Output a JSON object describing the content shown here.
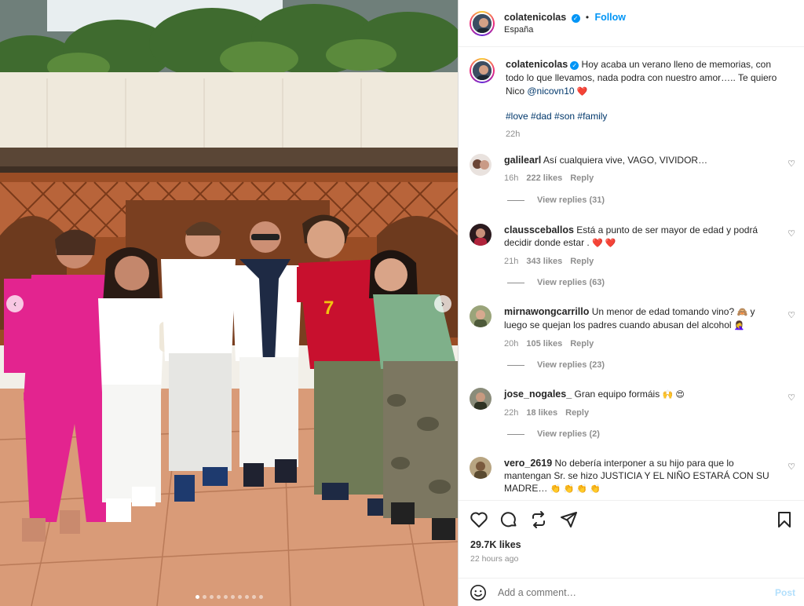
{
  "post": {
    "username": "colatenicolas",
    "follow_label": "Follow",
    "separator": "•",
    "location": "España",
    "caption": {
      "text": "Hoy acaba un verano lleno de memorias, con todo lo que llevamos, nada podra con nuestro amor….. Te quiero Nico",
      "mention": "@nicovn10",
      "emoji": "❤️",
      "hashtags": "#love #dad #son #family",
      "time": "22h"
    },
    "carousel": {
      "total_slides": 10,
      "active_slide": 1
    }
  },
  "comments": [
    {
      "username": "galilearl",
      "text": "Así cualquiera vive, VAGO, VIVIDOR…",
      "time": "16h",
      "likes": "222 likes",
      "reply": "Reply",
      "view_replies": "View replies (31)"
    },
    {
      "username": "claussceballos",
      "text": "Está a punto de ser mayor de edad y podrá decidir donde estar .",
      "emoji": "❤️ ❤️",
      "time": "21h",
      "likes": "343 likes",
      "reply": "Reply",
      "view_replies": "View replies (63)"
    },
    {
      "username": "mirnawongcarrillo",
      "text": "Un menor de edad tomando vino?",
      "emoji": "🙈",
      "text2": "y luego se quejan los padres cuando abusan del alcohol",
      "emoji2": "🤦‍♀️",
      "time": "20h",
      "likes": "105 likes",
      "reply": "Reply",
      "view_replies": "View replies (23)"
    },
    {
      "username": "jose_nogales_",
      "text": "Gran equipo formáis",
      "emoji": "🙌 😍",
      "time": "22h",
      "likes": "18 likes",
      "reply": "Reply",
      "view_replies": "View replies (2)"
    },
    {
      "username": "vero_2619",
      "text": "No debería interponer a su hijo para que lo mantengan Sr. se hizo JUSTICIA Y EL NIÑO ESTARÁ CON SU MADRE…",
      "emoji": "👏 👏 👏 👏"
    }
  ],
  "footer": {
    "likes": "29.7K likes",
    "time_ago": "22 hours ago",
    "add_comment_placeholder": "Add a comment…",
    "post_label": "Post"
  },
  "icons": {
    "verified": "verified-badge-icon",
    "like": "heart-icon",
    "comment": "comment-bubble-icon",
    "share": "repost-icon",
    "send": "paper-plane-icon",
    "save": "bookmark-icon",
    "emoji": "smiley-icon",
    "prev": "chevron-left-icon",
    "next": "chevron-right-icon"
  },
  "colors": {
    "link": "#00376b",
    "accent": "#0095f6",
    "heart": "#ed4956",
    "muted": "#8e8e8e"
  }
}
